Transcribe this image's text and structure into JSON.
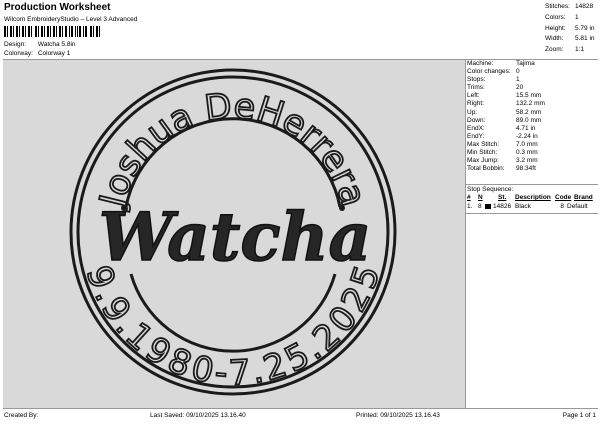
{
  "header": {
    "title": "Production Worksheet",
    "subtitle": "Wilcom EmbroideryStudio – Level 3 Advanced"
  },
  "design_info": {
    "design_label": "Design:",
    "design_value": "Watcha 5.8in",
    "colorway_label": "Colorway:",
    "colorway_value": "Colorway 1"
  },
  "stats": [
    {
      "label": "Stitches:",
      "value": "14828"
    },
    {
      "label": "Colors:",
      "value": "1"
    },
    {
      "label": "Height:",
      "value": "5.79 in"
    },
    {
      "label": "Width:",
      "value": "5.81 in"
    },
    {
      "label": "Zoom:",
      "value": "1:1"
    }
  ],
  "machine": [
    {
      "label": "Machine:",
      "value": "Tajima"
    },
    {
      "label": "Color changes:",
      "value": "0"
    },
    {
      "label": "Stops:",
      "value": "1"
    },
    {
      "label": "Trims:",
      "value": "20"
    },
    {
      "label": "Left:",
      "value": "15.5 mm"
    },
    {
      "label": "Right:",
      "value": "132.2 mm"
    },
    {
      "label": "Up:",
      "value": "58.2 mm"
    },
    {
      "label": "Down:",
      "value": "89.0 mm"
    },
    {
      "label": "EndX:",
      "value": "4.71 in"
    },
    {
      "label": "EndY:",
      "value": "-2.24 in"
    },
    {
      "label": "Max Stitch:",
      "value": "7.0 mm"
    },
    {
      "label": "Min Stitch:",
      "value": "0.3 mm"
    },
    {
      "label": "Max Jump:",
      "value": "3.2 mm"
    },
    {
      "label": "Total Bobbin:",
      "value": "98.34ft"
    }
  ],
  "stop_sequence": {
    "title": "Stop Sequence:",
    "columns": [
      "#",
      "N",
      "St.",
      "Description",
      "Code",
      "Brand"
    ],
    "rows": [
      {
        "index": "1.",
        "needle": "8",
        "stitches": "14826",
        "description": "Black",
        "code": "8",
        "brand": "Default",
        "color": "#000000"
      }
    ]
  },
  "design_text": {
    "top_arc": "Joshua DeHerrera",
    "center": "Watcha",
    "bottom_arc": "9.9.1980-7.25.2025"
  },
  "footer": {
    "created_by": "Created By:",
    "last_saved": "Last Saved: 09/10/2025 13.16.40",
    "printed": "Printed: 09/10/2025 13.16.43",
    "page": "Page 1 of 1"
  },
  "colors": {
    "thread": "#1a1a1a",
    "canvas": "#d9d9d9"
  }
}
